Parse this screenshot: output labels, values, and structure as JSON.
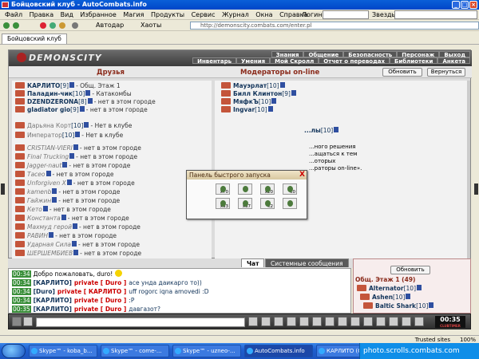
{
  "window": {
    "title": "Бойцовский клуб - AutoCombats.info"
  },
  "menu": {
    "items": [
      "Файл",
      "Правка",
      "Вид",
      "Избранное",
      "Магия",
      "Продукты",
      "Сервис",
      "Журнал",
      "Окна",
      "Справка"
    ],
    "login_label": "Логин:",
    "stars_label": "Звезды:"
  },
  "toolbar": {
    "autoban": "Автодар",
    "haos": "Хаоты",
    "address": "http://demonscity.combats.com/enter.pl"
  },
  "tab": {
    "label": "Бойцовский клуб"
  },
  "site": {
    "brand": "DEMONSCITY",
    "nav_top": [
      "Знания",
      "Общение",
      "Безопасность",
      "Персонаж",
      "Выход"
    ],
    "nav_bottom": [
      "Инвентарь",
      "Умения",
      "Мой Скролл",
      "Отчет о переводах",
      "Библиотеки",
      "Анкета"
    ]
  },
  "friends": {
    "title": "Друзья",
    "refresh": "Обновить",
    "rows": [
      {
        "name": "КАРЛИТО",
        "level": "[9]",
        "status": "- Общ. Этаж 1",
        "online": true
      },
      {
        "name": "Паладин-чик",
        "level": "[10]",
        "status": "- Катакомбы",
        "online": true
      },
      {
        "name": "DZENDZERONA",
        "level": "[8]",
        "status": "- нет в этом городе",
        "online": true
      },
      {
        "name": "gladiator gio",
        "level": "[9]",
        "status": "- нет в этом городе",
        "online": true
      },
      {
        "name": "Дарьяна Корт",
        "level": "[10]",
        "status": "- Нет в клубе",
        "online": false
      },
      {
        "name": "Император",
        "level": "[10]",
        "status": "- Нет в клубе",
        "online": false
      },
      {
        "name": "CRISTIAN-VIERI",
        "level": "",
        "status": "- нет в этом городе",
        "online": false
      },
      {
        "name": "Final Trucking",
        "level": "",
        "status": "- нет в этом городе",
        "online": false
      },
      {
        "name": "Jagger-naut",
        "level": "",
        "status": "- нет в этом городе",
        "online": false
      },
      {
        "name": "Тасео",
        "level": "",
        "status": "- нет в этом городе",
        "online": false
      },
      {
        "name": "Unforgiven X",
        "level": "",
        "status": "- нет в этом городе",
        "online": false
      },
      {
        "name": "kamenb",
        "level": "",
        "status": "- нет в этом городе",
        "online": false
      },
      {
        "name": "Гайжин",
        "level": "",
        "status": "- нет в этом городе",
        "online": false
      },
      {
        "name": "Кето",
        "level": "",
        "status": "- нет в этом городе",
        "online": false
      },
      {
        "name": "Константа",
        "level": "",
        "status": "- нет в этом городе",
        "online": false
      },
      {
        "name": "Махмуд герой",
        "level": "",
        "status": "- нет в этом городе",
        "online": false
      },
      {
        "name": "РАВИН",
        "level": "",
        "status": "- нет в этом городе",
        "online": false
      },
      {
        "name": "Ударная Сила",
        "level": "",
        "status": "- нет в этом городе",
        "online": false
      },
      {
        "name": "ШЕРШЕМБИЕВ",
        "level": "",
        "status": "- нет в этом городе",
        "online": false
      }
    ]
  },
  "moderators": {
    "title": "Модераторы on-line",
    "return": "Вернуться",
    "rows": [
      {
        "name": "Мауэрлат",
        "level": "[10]"
      },
      {
        "name": "Билл Клинтон",
        "level": "[9]"
      },
      {
        "name": "МяфкЪ",
        "level": "[10]"
      },
      {
        "name": "Ingvar",
        "level": "[10]"
      },
      {
        "name": "...лы",
        "level": "[10]"
      }
    ],
    "info": [
      "...ного решения",
      "...ащаться к тем",
      "...оторых",
      "...раторы on-line»."
    ]
  },
  "popup": {
    "title": "Панель быстрого запуска",
    "close": "X",
    "slots": [
      "x70",
      "",
      "x20",
      "x0",
      "x33",
      "x37",
      "x2",
      ""
    ]
  },
  "chat": {
    "tab_chat": "Чат",
    "tab_system": "Системные сообщения",
    "lines": [
      {
        "time": "00:34",
        "who": "",
        "mode": "",
        "msg": "Добро пожаловать, duro!"
      },
      {
        "time": "00:34",
        "who": "[КАРЛИТО]",
        "mode": "private [ Duro ]",
        "msg": "асе унда даикарго то))"
      },
      {
        "time": "00:34",
        "who": "[Duro]",
        "mode": "private [ КАРЛИТО ]",
        "msg": "uff rogorc iqna amovedi :D"
      },
      {
        "time": "00:34",
        "who": "[КАРЛИТО]",
        "mode": "private [ Duro ]",
        "msg": ":P"
      },
      {
        "time": "00:35",
        "who": "[КАРЛИТО]",
        "mode": "private [ Duro ]",
        "msg": "давгазот?"
      }
    ]
  },
  "online": {
    "refresh": "Обновить",
    "location": "Общ. Этаж 1 (49)",
    "users": [
      {
        "name": "Alternator",
        "level": "[10]"
      },
      {
        "name": "Ashen",
        "level": "[10]"
      },
      {
        "name": "Baltic Shark",
        "level": "[10]"
      }
    ]
  },
  "clock": {
    "time": "00:35",
    "label": "CLUBTIMER"
  },
  "status": {
    "trusted": "Trusted sites",
    "zoom": "100%"
  },
  "taskbar": {
    "tasks": [
      "Skype™ - koba_b...",
      "Skype™ - come-...",
      "Skype™ - uzneo-...",
      "AutoCombats.info",
      "КАРЛИТО (Online)"
    ],
    "tray": "photo.scrolls.combats.com"
  }
}
